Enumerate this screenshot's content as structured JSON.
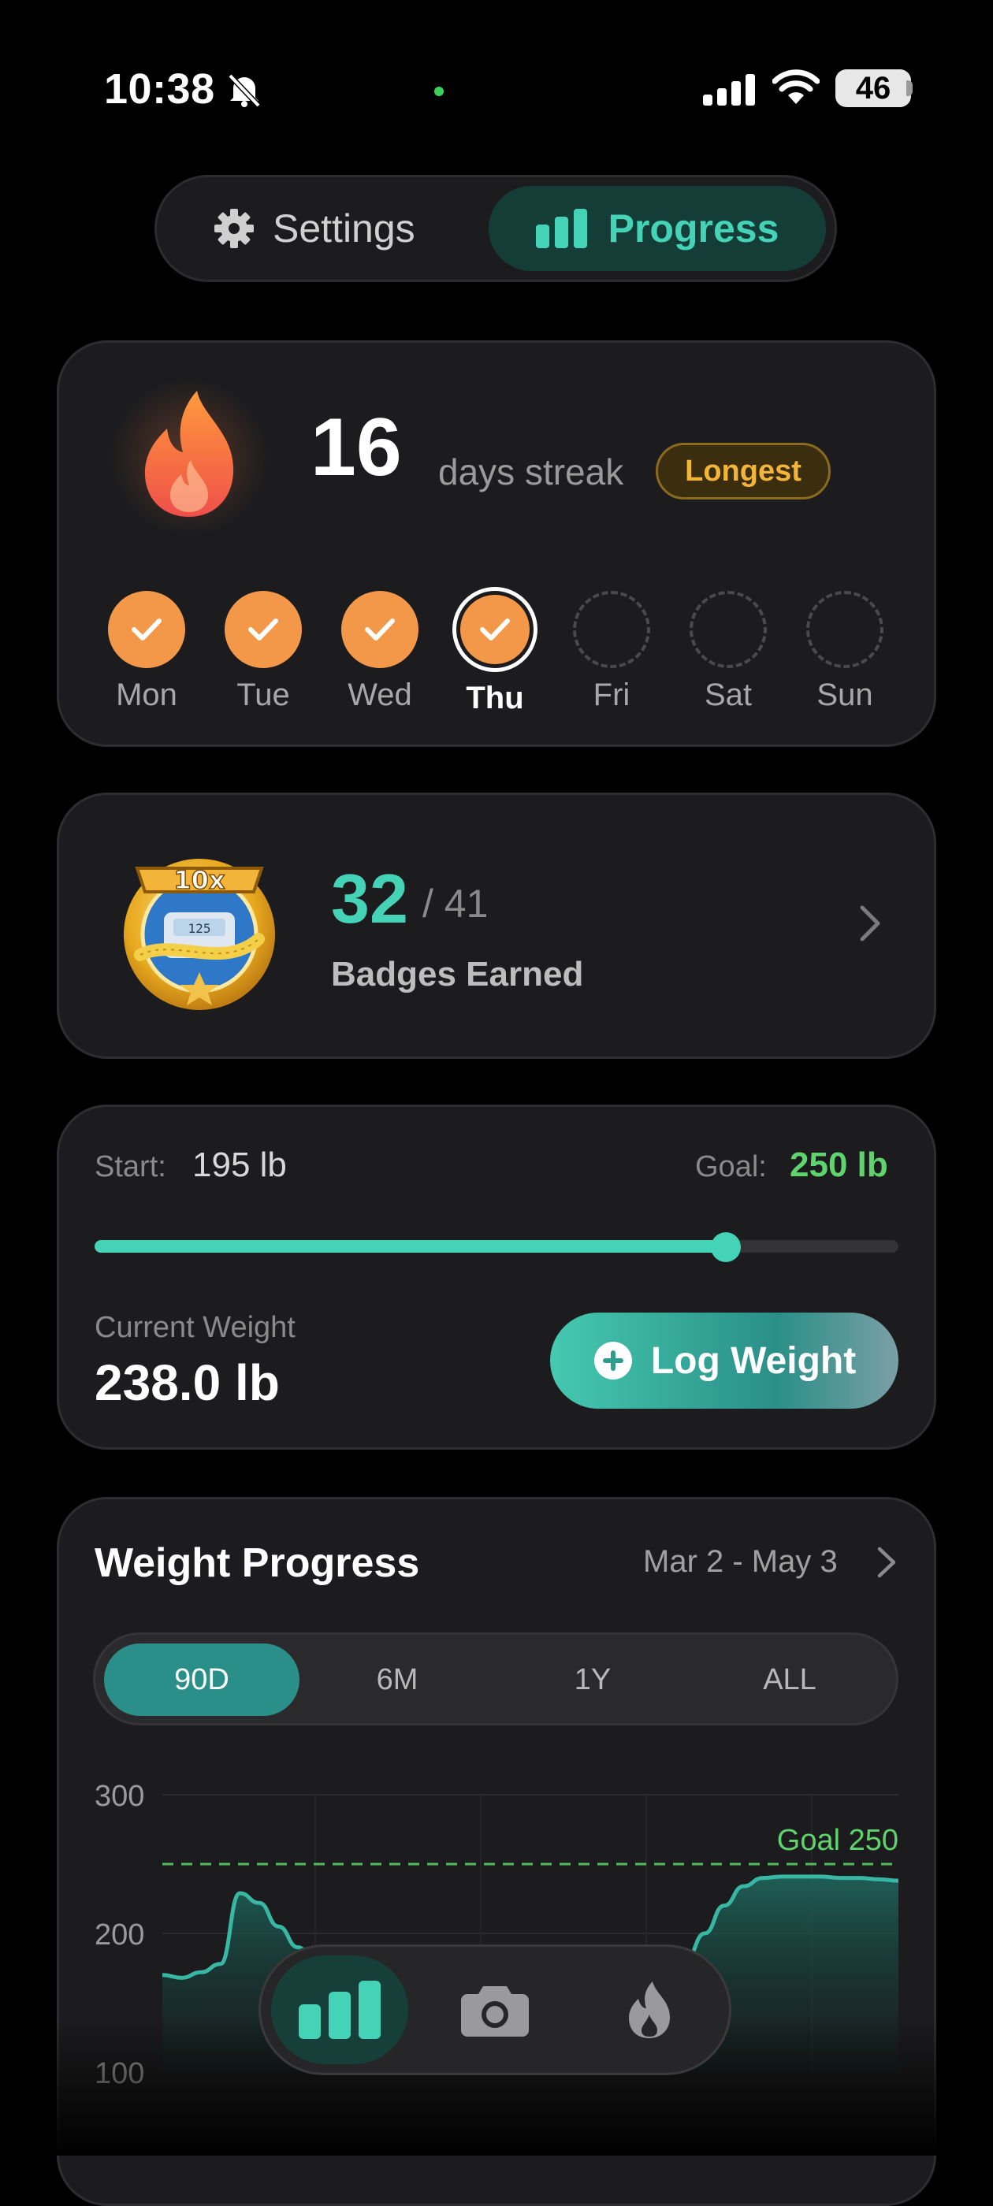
{
  "status_bar": {
    "time": "10:38",
    "battery": "46"
  },
  "segment": {
    "settings_label": "Settings",
    "progress_label": "Progress",
    "active": "Progress"
  },
  "streak": {
    "count": "16",
    "label": "days streak",
    "badge": "Longest",
    "days": [
      {
        "label": "Mon",
        "state": "done"
      },
      {
        "label": "Tue",
        "state": "done"
      },
      {
        "label": "Wed",
        "state": "done"
      },
      {
        "label": "Thu",
        "state": "today"
      },
      {
        "label": "Fri",
        "state": "empty"
      },
      {
        "label": "Sat",
        "state": "empty"
      },
      {
        "label": "Sun",
        "state": "empty"
      }
    ]
  },
  "badges": {
    "earned": "32",
    "total": "/ 41",
    "label": "Badges Earned",
    "medal_text": "10x",
    "scale_text": "125"
  },
  "weight": {
    "start_label": "Start:",
    "start_value": "195 lb",
    "goal_label": "Goal:",
    "goal_value": "250 lb",
    "progress_fraction": 0.785,
    "current_label": "Current Weight",
    "current_value": "238.0 lb",
    "log_button": "Log Weight"
  },
  "weight_progress": {
    "title": "Weight Progress",
    "date_range": "Mar 2 - May 3",
    "tabs": [
      "90D",
      "6M",
      "1Y",
      "ALL"
    ],
    "active_tab": "90D"
  },
  "chart_data": {
    "type": "area",
    "title": "",
    "xlabel": "",
    "ylabel": "",
    "ylim": [
      100,
      300
    ],
    "y_ticks": [
      "300",
      "200",
      "100"
    ],
    "goal_line": {
      "value": 250,
      "label": "Goal 250"
    },
    "series": [
      {
        "values": [
          170,
          168,
          172,
          178,
          229,
          222,
          205,
          190,
          176,
          165,
          160,
          158,
          156,
          155,
          154,
          154,
          155,
          156,
          157,
          158,
          160,
          162,
          163,
          165,
          166,
          168,
          172,
          180,
          200,
          220,
          234,
          240,
          241,
          241,
          241,
          240,
          240,
          239,
          238
        ]
      }
    ]
  },
  "tab_bar": {
    "items": [
      "progress-tab",
      "camera-tab",
      "streak-tab"
    ],
    "active": "progress-tab"
  },
  "colors": {
    "accent": "#45d3b8",
    "streak": "#f39848",
    "goal": "#5fd36d",
    "badge_gold": "#f2b53a"
  }
}
